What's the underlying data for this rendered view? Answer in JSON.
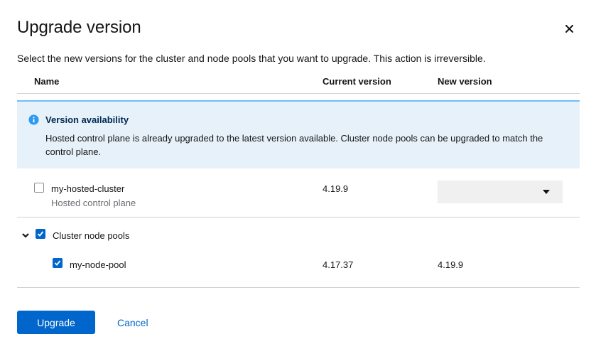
{
  "modal": {
    "title": "Upgrade version",
    "description": "Select the new versions for the cluster and node pools that you want to upgrade. This action is irreversible."
  },
  "table": {
    "headers": {
      "name": "Name",
      "current": "Current version",
      "new": "New version"
    }
  },
  "alert": {
    "title": "Version availability",
    "body": "Hosted control plane is already upgraded to the latest version available. Cluster node pools can be upgraded to match the control plane."
  },
  "rows": {
    "cluster": {
      "name": "my-hosted-cluster",
      "subtitle": "Hosted control plane",
      "current": "4.19.9",
      "checked": false,
      "new_select_value": ""
    },
    "group": {
      "label": "Cluster node pools",
      "checked": true,
      "expanded": true
    },
    "node_pool": {
      "name": "my-node-pool",
      "current": "4.17.37",
      "new": "4.19.9",
      "checked": true
    }
  },
  "footer": {
    "primary": "Upgrade",
    "cancel": "Cancel"
  },
  "colors": {
    "primary": "#0066cc",
    "alert_bg": "#e7f1fa",
    "alert_border": "#73bcf7",
    "alert_title": "#002952"
  },
  "icons": {
    "close": "close-icon",
    "info": "info-circle-icon",
    "caret": "caret-down-icon",
    "toggle": "chevron-down-icon",
    "check": "check-icon"
  }
}
